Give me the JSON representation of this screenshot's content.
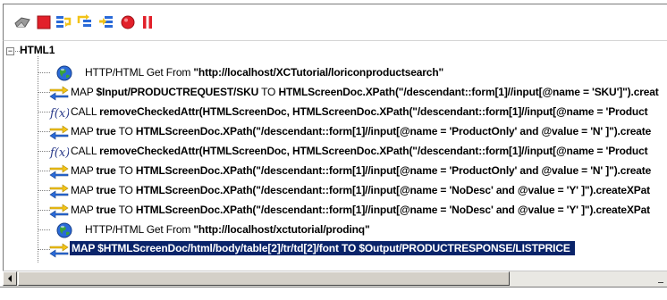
{
  "toolbar": {
    "buttons": [
      {
        "name": "eraser-icon"
      },
      {
        "name": "stop-square-icon"
      },
      {
        "name": "step-into-icon"
      },
      {
        "name": "step-over-icon"
      },
      {
        "name": "step-out-icon"
      },
      {
        "name": "record-icon"
      },
      {
        "name": "pause-icon"
      }
    ],
    "colors": {
      "red": "#e2202a",
      "blue": "#2a6ad8",
      "yellow": "#f2c318"
    }
  },
  "tree": {
    "root_label": "HTML1",
    "expand_glyph": "−",
    "rows": [
      {
        "icon": "globe-icon",
        "parts": [
          {
            "t": "HTTP/HTML Get From ",
            "b": false
          },
          {
            "t": "\"http://localhost/XCTutorial/loriconproductsearch\"",
            "b": true
          }
        ]
      },
      {
        "icon": "map-arrows-icon",
        "parts": [
          {
            "t": "MAP ",
            "b": false
          },
          {
            "t": "$Input/PRODUCTREQUEST/SKU",
            "b": true
          },
          {
            "t": " TO ",
            "b": false
          },
          {
            "t": "HTMLScreenDoc.XPath(\"/descendant::form[1]//input[@name = 'SKU']\").creat",
            "b": true
          }
        ]
      },
      {
        "icon": "function-icon",
        "parts": [
          {
            "t": "CALL ",
            "b": false
          },
          {
            "t": "removeCheckedAttr(HTMLScreenDoc, HTMLScreenDoc.XPath(\"/descendant::form[1]//input[@name = 'Product",
            "b": true
          }
        ]
      },
      {
        "icon": "map-arrows-icon",
        "parts": [
          {
            "t": "MAP ",
            "b": false
          },
          {
            "t": "true",
            "b": true
          },
          {
            "t": " TO ",
            "b": false
          },
          {
            "t": "HTMLScreenDoc.XPath(\"/descendant::form[1]//input[@name = 'ProductOnly' and @value = 'N' ]\").create",
            "b": true
          }
        ]
      },
      {
        "icon": "function-icon",
        "parts": [
          {
            "t": "CALL ",
            "b": false
          },
          {
            "t": "removeCheckedAttr(HTMLScreenDoc, HTMLScreenDoc.XPath(\"/descendant::form[1]//input[@name = 'Product",
            "b": true
          }
        ]
      },
      {
        "icon": "map-arrows-icon",
        "parts": [
          {
            "t": "MAP ",
            "b": false
          },
          {
            "t": "true",
            "b": true
          },
          {
            "t": " TO ",
            "b": false
          },
          {
            "t": "HTMLScreenDoc.XPath(\"/descendant::form[1]//input[@name = 'ProductOnly' and @value = 'N' ]\").create",
            "b": true
          }
        ]
      },
      {
        "icon": "map-arrows-icon",
        "parts": [
          {
            "t": "MAP ",
            "b": false
          },
          {
            "t": "true",
            "b": true
          },
          {
            "t": " TO ",
            "b": false
          },
          {
            "t": "HTMLScreenDoc.XPath(\"/descendant::form[1]//input[@name = 'NoDesc' and @value = 'Y' ]\").createXPat",
            "b": true
          }
        ]
      },
      {
        "icon": "map-arrows-icon",
        "parts": [
          {
            "t": "MAP ",
            "b": false
          },
          {
            "t": "true",
            "b": true
          },
          {
            "t": " TO ",
            "b": false
          },
          {
            "t": "HTMLScreenDoc.XPath(\"/descendant::form[1]//input[@name = 'NoDesc' and @value = 'Y' ]\").createXPat",
            "b": true
          }
        ]
      },
      {
        "icon": "globe-icon",
        "parts": [
          {
            "t": "HTTP/HTML Get From ",
            "b": false
          },
          {
            "t": "\"http://localhost/xctutorial/prodinq\"",
            "b": true
          }
        ]
      },
      {
        "icon": "map-arrows-icon",
        "selected": true,
        "parts": [
          {
            "t": "MAP $HTMLScreenDoc/html/body/table[2]/tr/td[2]/font TO $Output/PRODUCTRESPONSE/LISTPRICE",
            "b": false
          }
        ]
      }
    ]
  },
  "selection_color": "#0a246a"
}
